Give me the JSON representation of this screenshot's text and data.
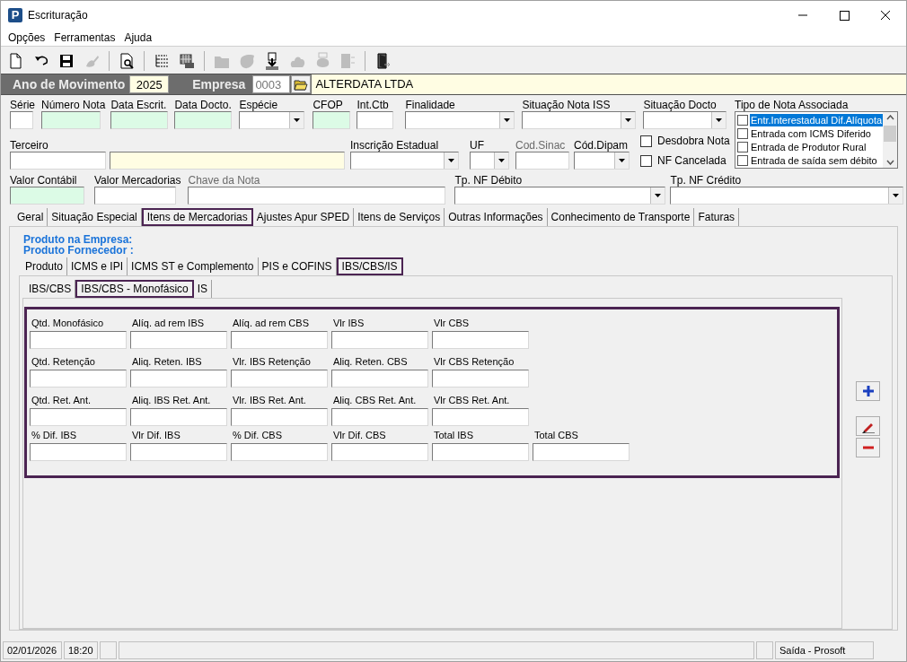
{
  "window": {
    "icon_text": "P",
    "title": "Escrituração"
  },
  "menu": [
    "Opções",
    "Ferramentas",
    "Ajuda"
  ],
  "toolbar": [
    {
      "kind": "new",
      "disabled": false
    },
    {
      "kind": "undo",
      "disabled": false
    },
    {
      "kind": "save",
      "disabled": false
    },
    {
      "kind": "brush",
      "disabled": true
    },
    {
      "kind": "separator"
    },
    {
      "kind": "preview",
      "disabled": false
    },
    {
      "kind": "separator"
    },
    {
      "kind": "tree",
      "disabled": false
    },
    {
      "kind": "grid",
      "disabled": false
    },
    {
      "kind": "separator"
    },
    {
      "kind": "folder",
      "disabled": true
    },
    {
      "kind": "blob",
      "disabled": true
    },
    {
      "kind": "download",
      "disabled": false
    },
    {
      "kind": "cloud",
      "disabled": true
    },
    {
      "kind": "stamp",
      "disabled": true
    },
    {
      "kind": "panel",
      "disabled": true
    },
    {
      "kind": "separator"
    },
    {
      "kind": "exit",
      "disabled": false
    }
  ],
  "header": {
    "year_label": "Ano de Movimento",
    "year": "2025",
    "company_label": "Empresa",
    "company_code": "0003",
    "company_name": "ALTERDATA LTDA"
  },
  "row1": [
    {
      "label": "Série",
      "kind": "text",
      "disabled": false
    },
    {
      "label": "Número Nota",
      "kind": "required",
      "disabled": false
    },
    {
      "label": "Data Escrit.",
      "kind": "required",
      "disabled": false
    },
    {
      "label": "Data Docto.",
      "kind": "required",
      "disabled": false
    },
    {
      "label": "Espécie",
      "kind": "select",
      "disabled": false
    },
    {
      "label": "CFOP",
      "kind": "required",
      "disabled": false
    },
    {
      "label": "Int.Ctb",
      "kind": "text",
      "disabled": false
    },
    {
      "label": "Finalidade",
      "kind": "select",
      "disabled": false
    },
    {
      "label": "Situação Nota ISS",
      "kind": "select",
      "disabled": false
    },
    {
      "label": "Situação Docto",
      "kind": "select",
      "disabled": false
    }
  ],
  "row2": [
    {
      "label": "Terceiro",
      "kind": "text",
      "disabled": false
    },
    {
      "kind": "lookup",
      "disabled": false
    },
    {
      "label": "Inscrição Estadual",
      "kind": "select",
      "disabled": false
    },
    {
      "label": "UF",
      "kind": "select",
      "disabled": false
    },
    {
      "label": "Cod.Sinac",
      "kind": "text",
      "disabled": true
    },
    {
      "label": "Cód.Dipam",
      "kind": "select",
      "disabled": false
    }
  ],
  "checkboxes": [
    {
      "label": "Desdobra Nota",
      "checked": false
    },
    {
      "label": "NF Cancelada",
      "checked": false
    }
  ],
  "tipo_nota": {
    "label": "Tipo de Nota Associada",
    "items": [
      {
        "label": "Entr.Interestadual Dif.Alíquota",
        "checked": false,
        "selected": true
      },
      {
        "label": "Entrada com ICMS Diferido",
        "checked": false,
        "selected": false
      },
      {
        "label": "Entrada de Produtor Rural",
        "checked": false,
        "selected": false
      },
      {
        "label": "Entrada de saída sem débito",
        "checked": false,
        "selected": false
      }
    ]
  },
  "row3": [
    {
      "label": "Valor Contábil",
      "kind": "required",
      "disabled": false
    },
    {
      "label": "Valor Mercadorias",
      "kind": "text",
      "disabled": false
    },
    {
      "label": "Chave da Nota",
      "kind": "text",
      "disabled": true
    },
    {
      "label": "Tp. NF Débito",
      "kind": "select",
      "disabled": false
    },
    {
      "label": "Tp. NF Crédito",
      "kind": "select",
      "disabled": false
    }
  ],
  "tabs": [
    {
      "label": "Geral",
      "selected": false
    },
    {
      "label": "Situação Especial",
      "selected": false
    },
    {
      "label": "Itens de Mercadorias",
      "selected": true
    },
    {
      "label": "Ajustes Apur SPED",
      "selected": false
    },
    {
      "label": "Itens de Serviços",
      "selected": false
    },
    {
      "label": "Outras Informações",
      "selected": false
    },
    {
      "label": "Conhecimento de Transporte",
      "selected": false
    },
    {
      "label": "Faturas",
      "selected": false
    }
  ],
  "product_labels": [
    "Produto na Empresa:",
    "Produto Fornecedor :"
  ],
  "subtabs": [
    {
      "label": "Produto",
      "selected": false
    },
    {
      "label": "ICMS e IPI",
      "selected": false
    },
    {
      "label": "ICMS ST e Complemento",
      "selected": false
    },
    {
      "label": "PIS e COFINS",
      "selected": false
    },
    {
      "label": "IBS/CBS/IS",
      "selected": true
    }
  ],
  "inner_tabs": [
    {
      "label": "IBS/CBS",
      "selected": false
    },
    {
      "label": "IBS/CBS - Monofásico",
      "selected": true
    },
    {
      "label": "IS",
      "selected": false
    }
  ],
  "grid": [
    [
      "Qtd. Monofásico",
      "Alíq. ad rem IBS",
      "Alíq. ad rem CBS",
      "Vlr IBS",
      "Vlr CBS"
    ],
    [
      "Qtd. Retenção",
      "Aliq. Reten. IBS",
      "Vlr. IBS Retenção",
      "Aliq. Reten. CBS",
      "Vlr CBS Retenção"
    ],
    [
      "Qtd. Ret. Ant.",
      "Aliq. IBS Ret. Ant.",
      "Vlr. IBS Ret. Ant.",
      "Aliq. CBS Ret. Ant.",
      "Vlr CBS Ret. Ant."
    ],
    [
      "% Dif. IBS",
      "Vlr Dif. IBS",
      "% Dif. CBS",
      "Vlr Dif. CBS",
      "Total IBS",
      "Total CBS"
    ]
  ],
  "side_buttons": [
    {
      "kind": "add"
    },
    {
      "kind": "edit"
    },
    {
      "kind": "delete"
    }
  ],
  "status_bar": [
    "02/01/2026",
    "18:20",
    "Saída - Prosoft"
  ]
}
